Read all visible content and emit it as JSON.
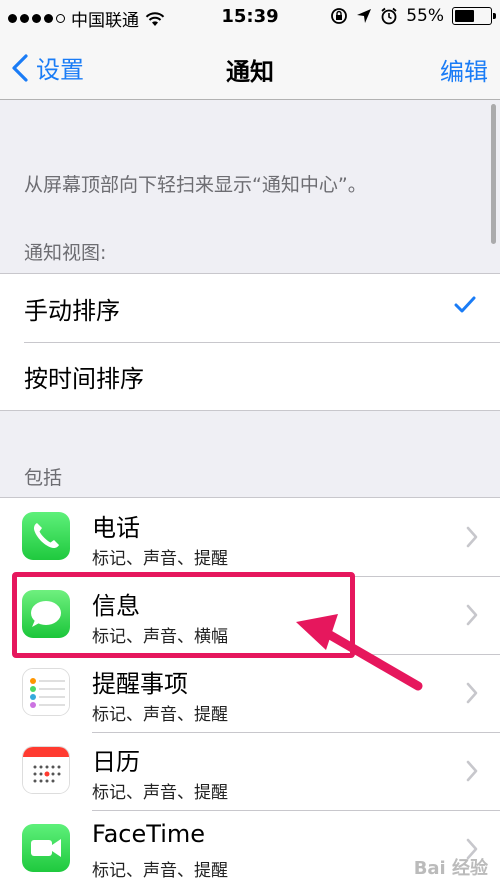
{
  "status": {
    "carrier": "中国联通",
    "time": "15:39",
    "battery_text": "55%",
    "battery_level": 0.55,
    "icons": [
      "signal-dots",
      "wifi-icon",
      "rotation-lock-icon",
      "location-icon",
      "alarm-icon",
      "battery-icon"
    ]
  },
  "nav": {
    "back_label": "设置",
    "title": "通知",
    "edit_label": "编辑"
  },
  "description": "从屏幕顶部向下轻扫来显示“通知中心”。",
  "view_section": {
    "header": "通知视图:",
    "options": [
      {
        "label": "手动排序",
        "checked": true
      },
      {
        "label": "按时间排序",
        "checked": false
      }
    ]
  },
  "include_section": {
    "header": "包括",
    "apps": [
      {
        "name": "电话",
        "subtitle": "标记、声音、提醒",
        "icon": "phone-app-icon"
      },
      {
        "name": "信息",
        "subtitle": "标记、声音、横幅",
        "icon": "messages-app-icon"
      },
      {
        "name": "提醒事项",
        "subtitle": "标记、声音、提醒",
        "icon": "reminders-app-icon"
      },
      {
        "name": "日历",
        "subtitle": "标记、声音、提醒",
        "icon": "calendar-app-icon"
      },
      {
        "name": "FaceTime",
        "subtitle": "标记、声音、提醒",
        "icon": "facetime-app-icon"
      }
    ]
  },
  "colors": {
    "accent": "#1a7cf6",
    "highlight": "#e6175d",
    "background": "#efeff4"
  },
  "watermark": "Bai 经验"
}
